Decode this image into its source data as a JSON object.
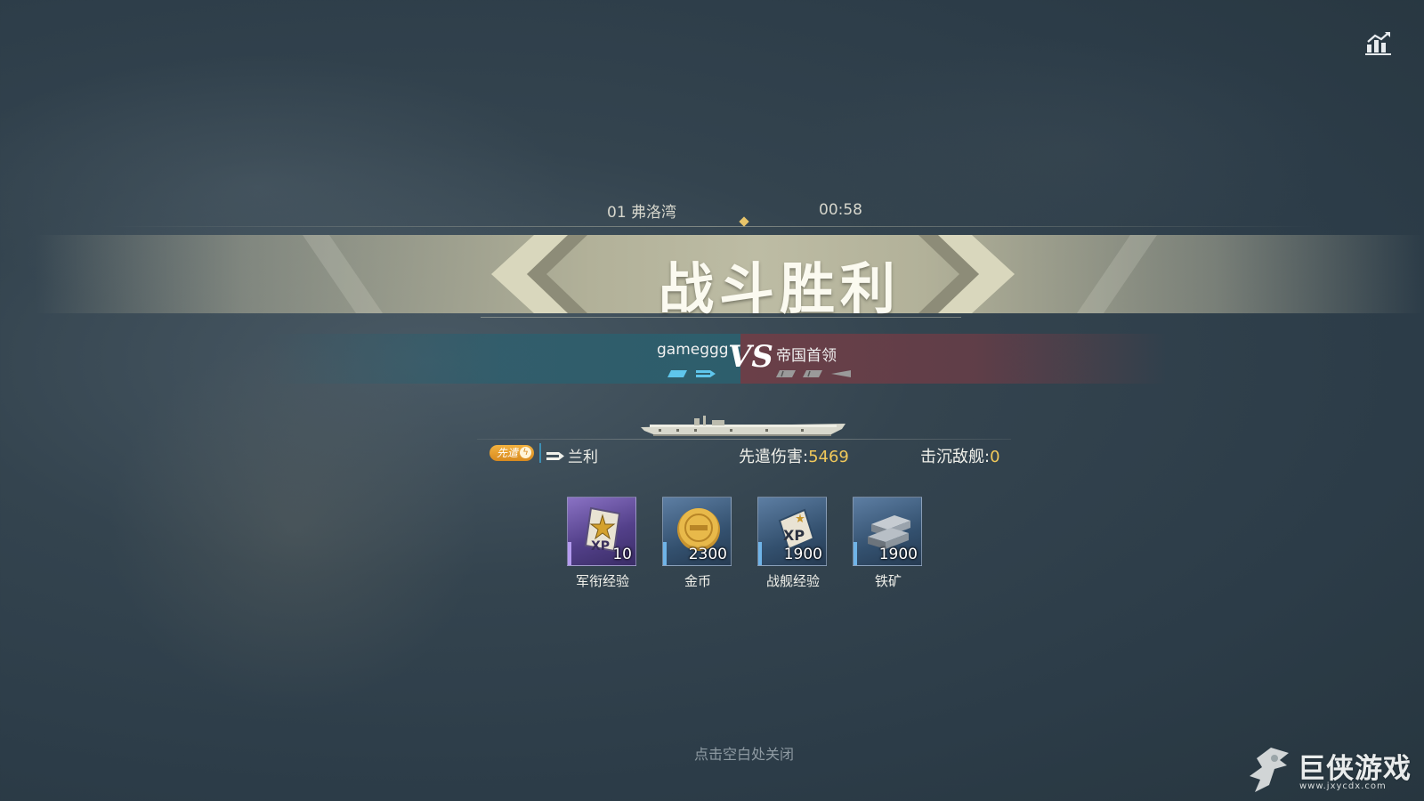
{
  "match": {
    "map": "01 弗洛湾",
    "time": "00:58"
  },
  "result": {
    "title": "战斗胜利"
  },
  "versus": {
    "player": "gameggg",
    "vs": "VS",
    "enemy": "帝国首领"
  },
  "ship": {
    "badge": "先遣",
    "name": "兰利",
    "damage_label": "先遣伤害:",
    "damage_value": "5469",
    "sunk_label": "击沉敌舰:",
    "sunk_value": "0"
  },
  "rewards": [
    {
      "label": "军衔经验",
      "amount": "10",
      "icon": "rank-xp-icon",
      "rarity": "purple"
    },
    {
      "label": "金币",
      "amount": "2300",
      "icon": "gold-coin-icon",
      "rarity": "blue"
    },
    {
      "label": "战舰经验",
      "amount": "1900",
      "icon": "ship-xp-icon",
      "rarity": "blue"
    },
    {
      "label": "铁矿",
      "amount": "1900",
      "icon": "iron-ore-icon",
      "rarity": "blue"
    }
  ],
  "close_hint": "点击空白处关闭",
  "watermark": {
    "title": "巨侠游戏",
    "url": "www.jxycdx.com"
  },
  "colors": {
    "accent_gold": "#f0c85a",
    "team_blue": "#2d5e6c",
    "team_red": "#6a3f48",
    "banner": "#b2b199"
  }
}
